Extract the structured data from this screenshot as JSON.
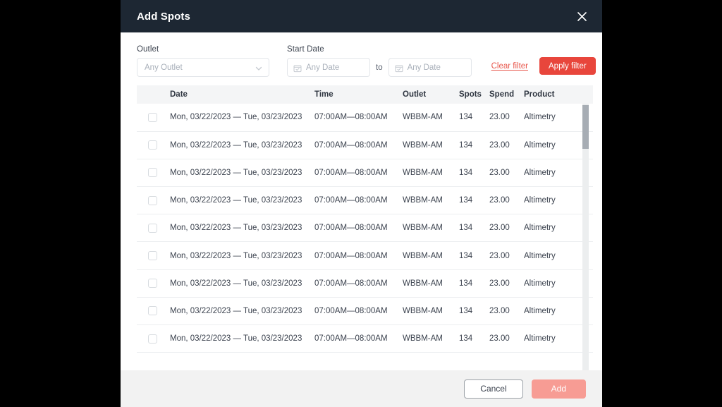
{
  "modal": {
    "title": "Add Spots",
    "close_icon": "close-icon"
  },
  "filters": {
    "outlet": {
      "label": "Outlet",
      "placeholder": "Any Outlet",
      "value": "",
      "chevron_icon": "chevron-down-icon"
    },
    "start_date": {
      "label": "Start Date",
      "from_placeholder": "Any Date",
      "from_value": "",
      "to_separator": "to",
      "to_placeholder": "Any Date",
      "to_value": "",
      "calendar_icon": "calendar-icon"
    },
    "clear_label": "Clear filter",
    "apply_label": "Apply filter",
    "accent_red": "#e8463c",
    "link_red": "#e8574c"
  },
  "table": {
    "columns": [
      "",
      "Date",
      "Time",
      "Outlet",
      "Spots",
      "Spend",
      "Product"
    ],
    "rows": [
      {
        "checked": false,
        "date": "Mon, 03/22/2023 — Tue, 03/23/2023",
        "time": "07:00AM—08:00AM",
        "outlet": "WBBM-AM",
        "spots": "134",
        "spend": "23.00",
        "product": "Altimetry"
      },
      {
        "checked": false,
        "date": "Mon, 03/22/2023 — Tue, 03/23/2023",
        "time": "07:00AM—08:00AM",
        "outlet": "WBBM-AM",
        "spots": "134",
        "spend": "23.00",
        "product": "Altimetry"
      },
      {
        "checked": false,
        "date": "Mon, 03/22/2023 — Tue, 03/23/2023",
        "time": "07:00AM—08:00AM",
        "outlet": "WBBM-AM",
        "spots": "134",
        "spend": "23.00",
        "product": "Altimetry"
      },
      {
        "checked": false,
        "date": "Mon, 03/22/2023 — Tue, 03/23/2023",
        "time": "07:00AM—08:00AM",
        "outlet": "WBBM-AM",
        "spots": "134",
        "spend": "23.00",
        "product": "Altimetry"
      },
      {
        "checked": false,
        "date": "Mon, 03/22/2023 — Tue, 03/23/2023",
        "time": "07:00AM—08:00AM",
        "outlet": "WBBM-AM",
        "spots": "134",
        "spend": "23.00",
        "product": "Altimetry"
      },
      {
        "checked": false,
        "date": "Mon, 03/22/2023 — Tue, 03/23/2023",
        "time": "07:00AM—08:00AM",
        "outlet": "WBBM-AM",
        "spots": "134",
        "spend": "23.00",
        "product": "Altimetry"
      },
      {
        "checked": false,
        "date": "Mon, 03/22/2023 — Tue, 03/23/2023",
        "time": "07:00AM—08:00AM",
        "outlet": "WBBM-AM",
        "spots": "134",
        "spend": "23.00",
        "product": "Altimetry"
      },
      {
        "checked": false,
        "date": "Mon, 03/22/2023 — Tue, 03/23/2023",
        "time": "07:00AM—08:00AM",
        "outlet": "WBBM-AM",
        "spots": "134",
        "spend": "23.00",
        "product": "Altimetry"
      },
      {
        "checked": false,
        "date": "Mon, 03/22/2023 — Tue, 03/23/2023",
        "time": "07:00AM—08:00AM",
        "outlet": "WBBM-AM",
        "spots": "134",
        "spend": "23.00",
        "product": "Altimetry"
      }
    ]
  },
  "footer": {
    "cancel_label": "Cancel",
    "add_label": "Add",
    "add_disabled": true
  }
}
